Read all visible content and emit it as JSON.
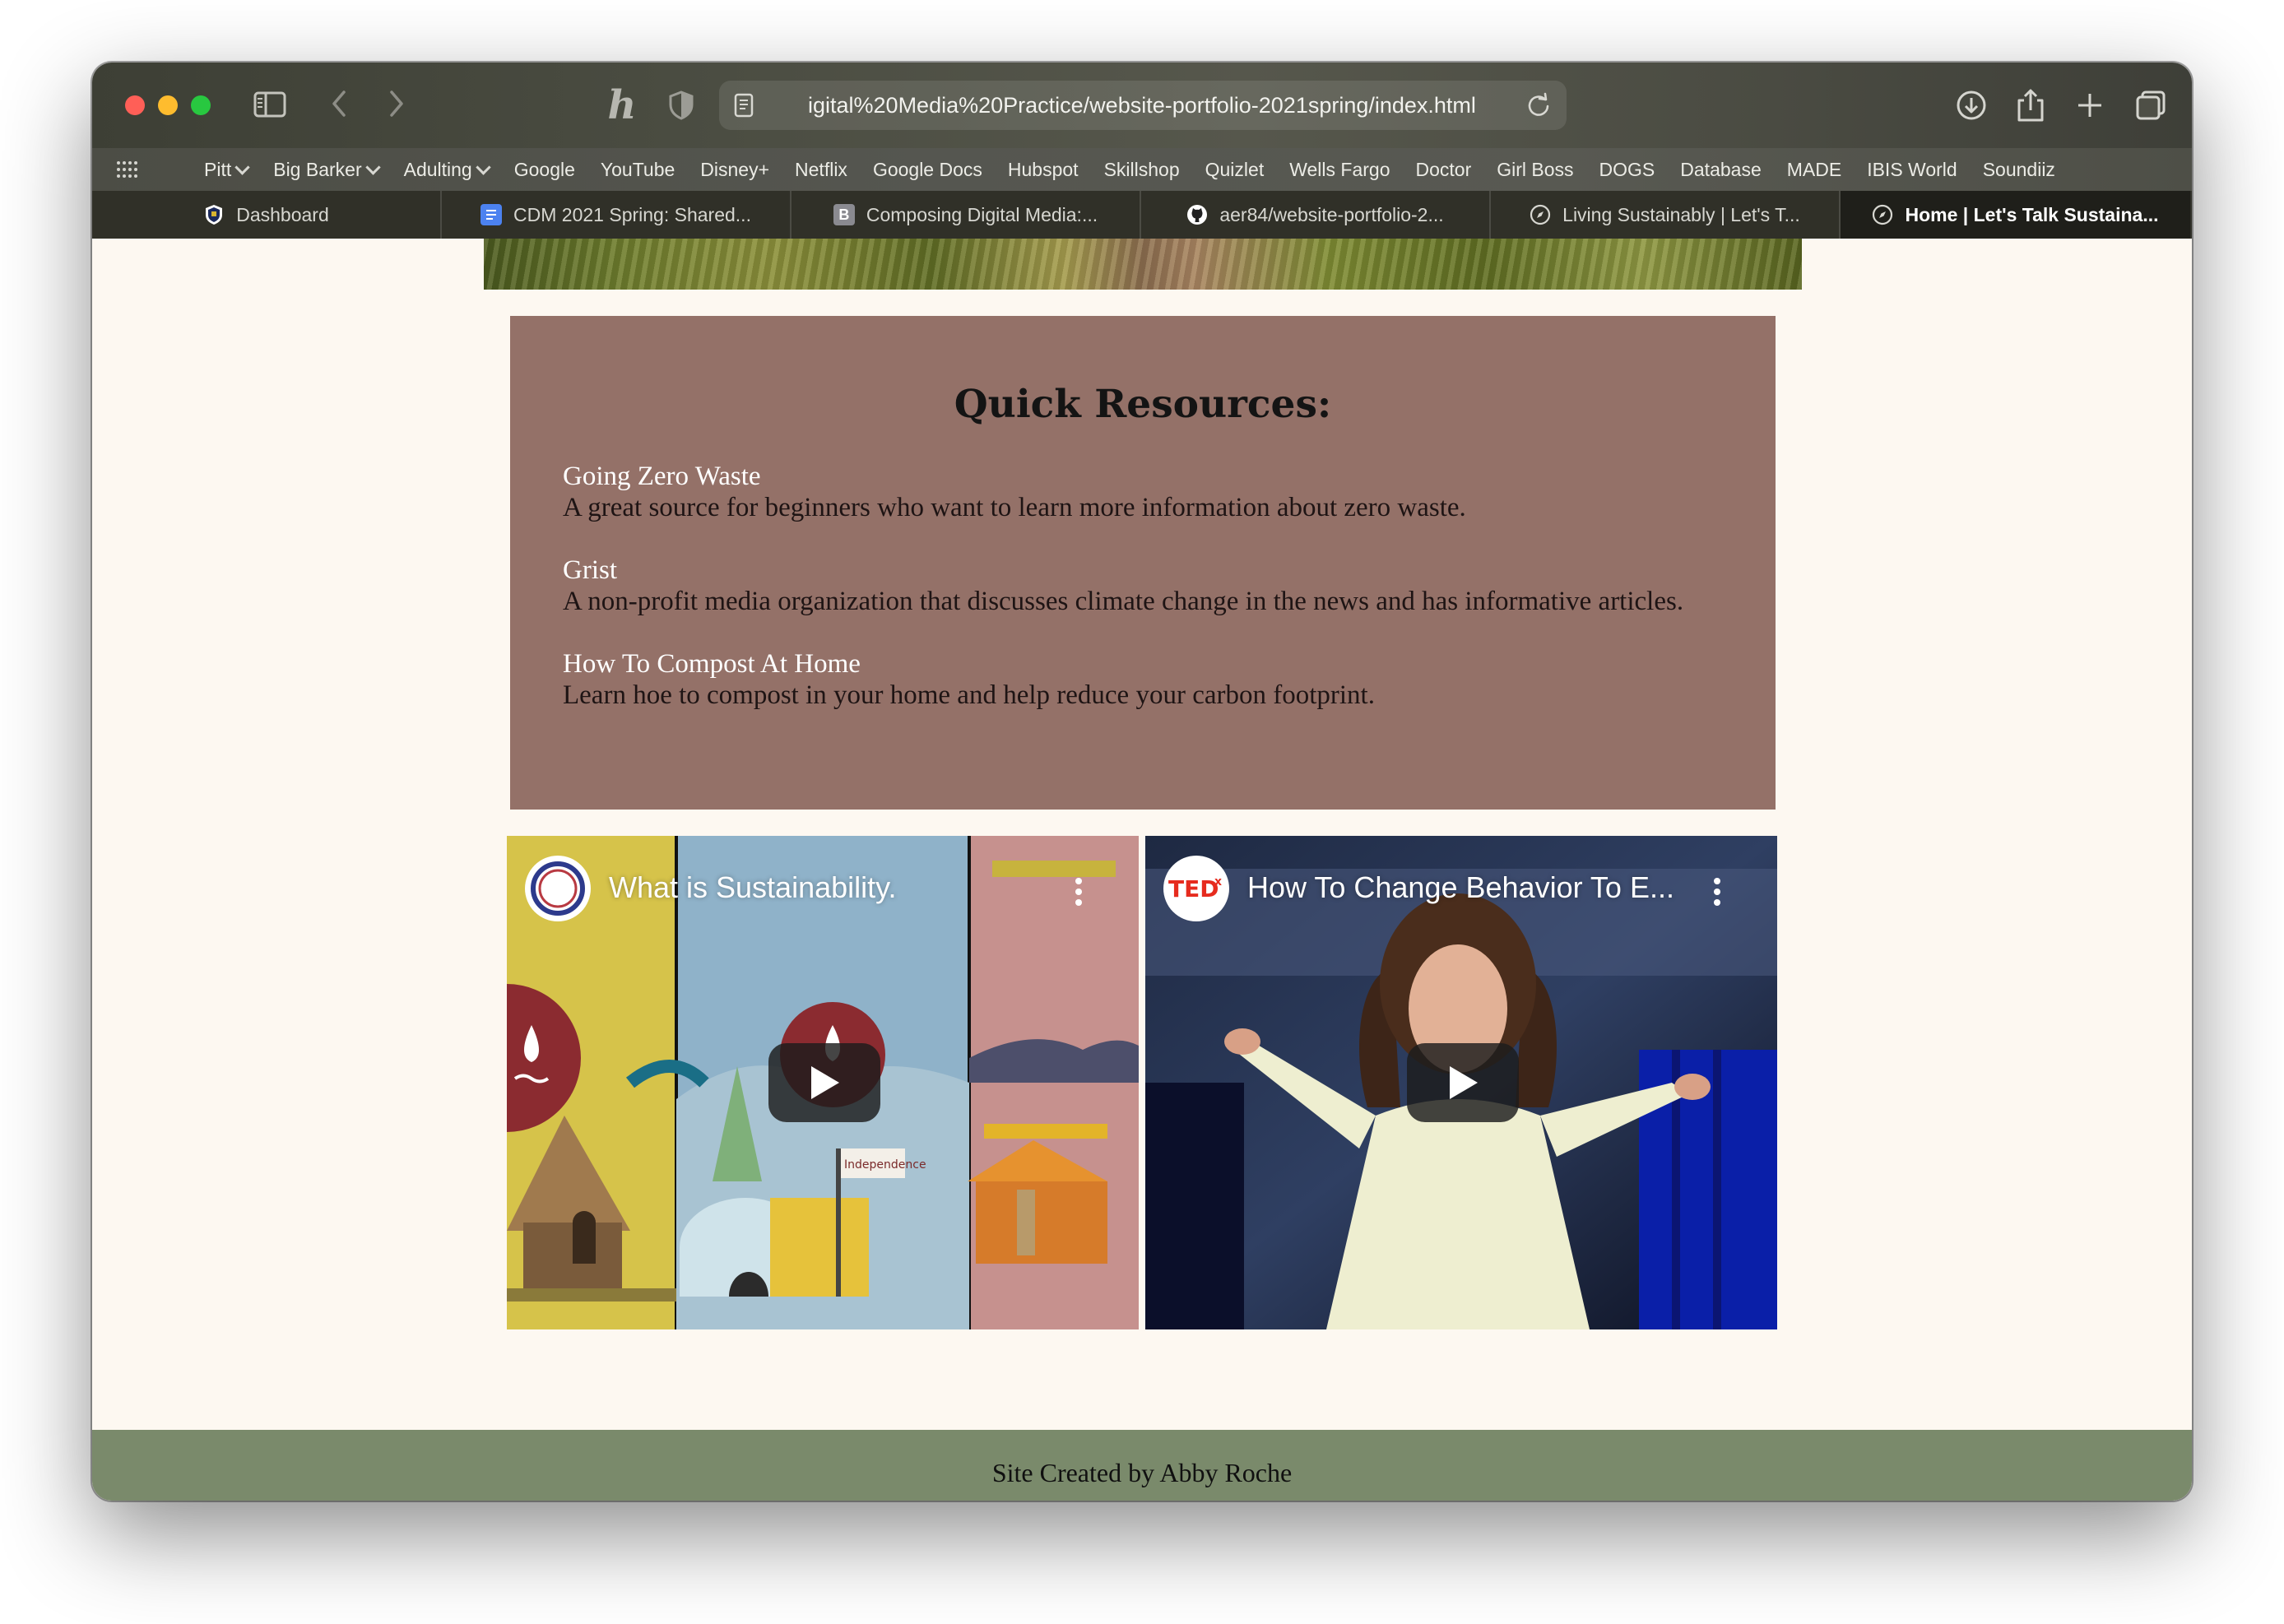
{
  "browser": {
    "url": "igital%20Media%20Practice/website-portfolio-2021spring/index.html",
    "bookmarks": [
      {
        "label": "Pitt",
        "dropdown": true
      },
      {
        "label": "Big Barker",
        "dropdown": true
      },
      {
        "label": "Adulting",
        "dropdown": true
      },
      {
        "label": "Google",
        "dropdown": false
      },
      {
        "label": "YouTube",
        "dropdown": false
      },
      {
        "label": "Disney+",
        "dropdown": false
      },
      {
        "label": "Netflix",
        "dropdown": false
      },
      {
        "label": "Google Docs",
        "dropdown": false
      },
      {
        "label": "Hubspot",
        "dropdown": false
      },
      {
        "label": "Skillshop",
        "dropdown": false
      },
      {
        "label": "Quizlet",
        "dropdown": false
      },
      {
        "label": "Wells Fargo",
        "dropdown": false
      },
      {
        "label": "Doctor",
        "dropdown": false
      },
      {
        "label": "Girl Boss",
        "dropdown": false
      },
      {
        "label": "DOGS",
        "dropdown": false
      },
      {
        "label": "Database",
        "dropdown": false
      },
      {
        "label": "MADE",
        "dropdown": false
      },
      {
        "label": "IBIS World",
        "dropdown": false
      },
      {
        "label": "Soundiiz",
        "dropdown": false
      }
    ],
    "tabs": [
      {
        "label": "Dashboard",
        "icon": "pitt-shield-icon"
      },
      {
        "label": "CDM 2021 Spring: Shared...",
        "icon": "google-docs-icon"
      },
      {
        "label": "Composing Digital Media:...",
        "icon": "blackboard-b-icon"
      },
      {
        "label": "aer84/website-portfolio-2...",
        "icon": "github-icon"
      },
      {
        "label": "Living Sustainably | Let's T...",
        "icon": "compass-icon"
      },
      {
        "label": "Home | Let's Talk Sustaina...",
        "icon": "compass-icon",
        "active": true
      }
    ]
  },
  "page": {
    "resources": {
      "title": "Quick Resources:",
      "items": [
        {
          "link": "Going Zero Waste",
          "desc": "A great source for beginners who want to learn more information about zero waste."
        },
        {
          "link": "Grist",
          "desc": "A non-profit media organization that discusses climate change in the news and has informative articles."
        },
        {
          "link": "How To Compost At Home",
          "desc": "Learn hoe to compost in your home and help reduce your carbon footprint."
        }
      ]
    },
    "videos": [
      {
        "title": "What is Sustainability.",
        "channel_icon": "circle-logo-icon"
      },
      {
        "title": "How To Change Behavior To E...",
        "channel_icon": "tedx-logo-icon",
        "channel_text": "TEDx"
      }
    ],
    "footer": "Site Created by Abby Roche"
  },
  "colors": {
    "resources_bg": "#947168",
    "footer_bg": "#7a8a6b",
    "page_bg": "#fdf8f1"
  }
}
